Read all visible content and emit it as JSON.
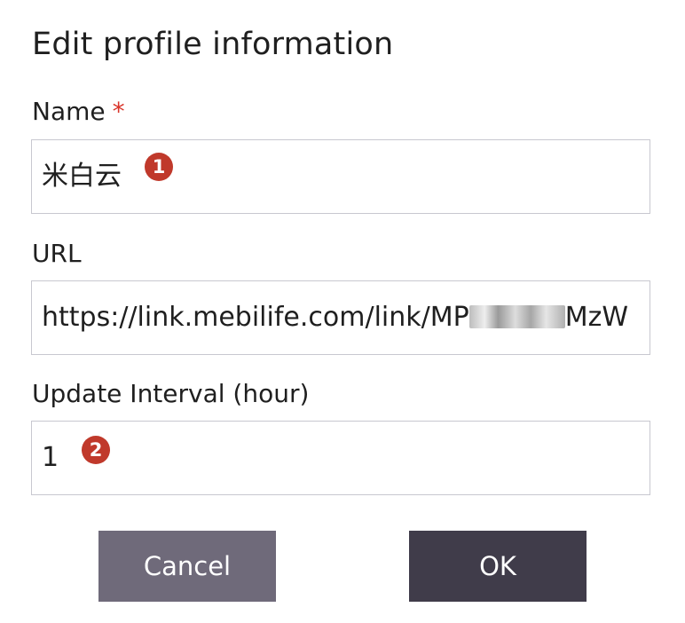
{
  "dialog": {
    "title": "Edit profile information",
    "name_label": "Name",
    "required_marker": "*",
    "name_value": "米白云",
    "name_badge": "1",
    "url_label": "URL",
    "url_value_start": "https://link.mebilife.com/link/MP",
    "url_value_end": "MzW",
    "interval_label": "Update Interval (hour)",
    "interval_value": "1",
    "interval_badge": "2",
    "cancel_label": "Cancel",
    "ok_label": "OK"
  },
  "colors": {
    "badge": "#c0392b",
    "required_marker": "#d9342a",
    "cancel_button": "#6f6a7a",
    "ok_button": "#403c4a",
    "input_border": "#c8c8d0"
  }
}
